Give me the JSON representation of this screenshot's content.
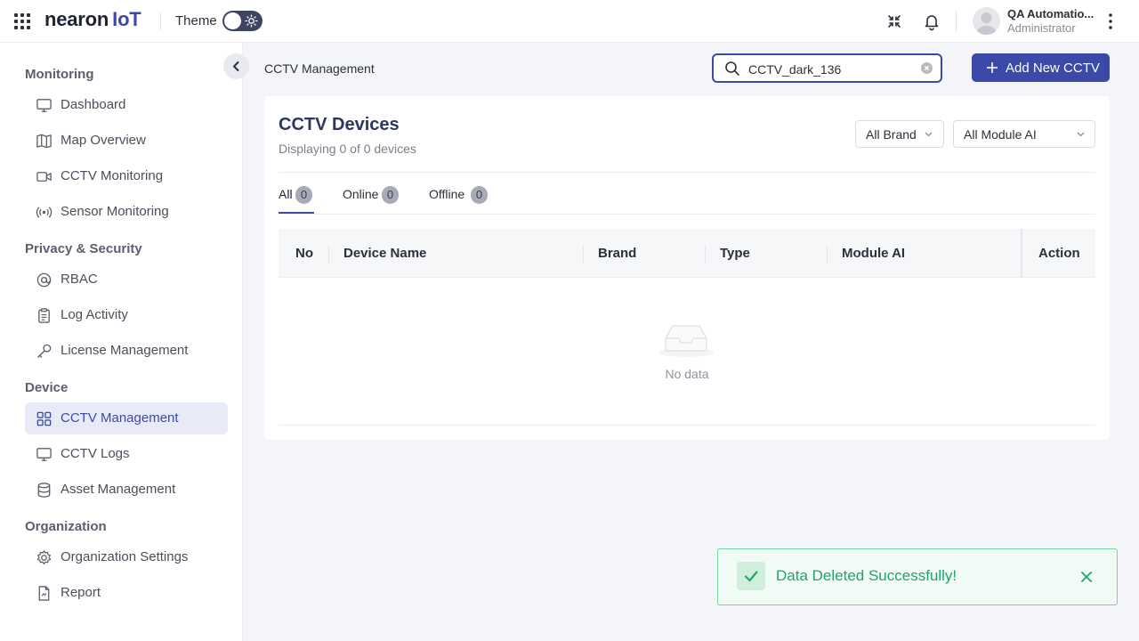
{
  "header": {
    "logo_text": "nearon",
    "logo_suffix": "IoT",
    "theme_label": "Theme",
    "user": {
      "name": "QA Automatio...",
      "role": "Administrator"
    }
  },
  "sidebar": {
    "sections": [
      {
        "title": "Monitoring",
        "items": [
          {
            "label": "Dashboard",
            "icon": "monitor-icon"
          },
          {
            "label": "Map Overview",
            "icon": "map-icon"
          },
          {
            "label": "CCTV Monitoring",
            "icon": "video-camera-icon"
          },
          {
            "label": "Sensor Monitoring",
            "icon": "broadcast-icon"
          }
        ]
      },
      {
        "title": "Privacy & Security",
        "items": [
          {
            "label": "RBAC",
            "icon": "at-sign-icon"
          },
          {
            "label": "Log Activity",
            "icon": "clipboard-icon"
          },
          {
            "label": "License Management",
            "icon": "key-icon"
          }
        ]
      },
      {
        "title": "Device",
        "items": [
          {
            "label": "CCTV Management",
            "icon": "apps-grid-icon",
            "active": true
          },
          {
            "label": "CCTV Logs",
            "icon": "monitor-icon"
          },
          {
            "label": "Asset Management",
            "icon": "database-icon"
          }
        ]
      },
      {
        "title": "Organization",
        "items": [
          {
            "label": "Organization Settings",
            "icon": "gear-icon"
          },
          {
            "label": "Report",
            "icon": "document-icon"
          }
        ]
      }
    ]
  },
  "main": {
    "page_title": "CCTV Management",
    "search": {
      "value": "CCTV_dark_136",
      "placeholder": ""
    },
    "add_button_label": "Add New CCTV",
    "card": {
      "title": "CCTV Devices",
      "subtitle": "Displaying 0 of 0 devices",
      "filters": {
        "brand": "All Brand",
        "module_ai": "All Module AI"
      },
      "tabs": [
        {
          "label": "All",
          "count": "0",
          "active": true
        },
        {
          "label": "Online",
          "count": "0"
        },
        {
          "label": "Offline",
          "count": "0"
        }
      ],
      "table": {
        "columns": [
          "No",
          "Device Name",
          "Brand",
          "Type",
          "Module AI",
          "Action"
        ],
        "rows": [],
        "empty_text": "No data"
      }
    }
  },
  "toast": {
    "message": "Data Deleted Successfully!",
    "status": "success"
  },
  "colors": {
    "accent": "#3b4aa8",
    "success": "#24a36b"
  }
}
